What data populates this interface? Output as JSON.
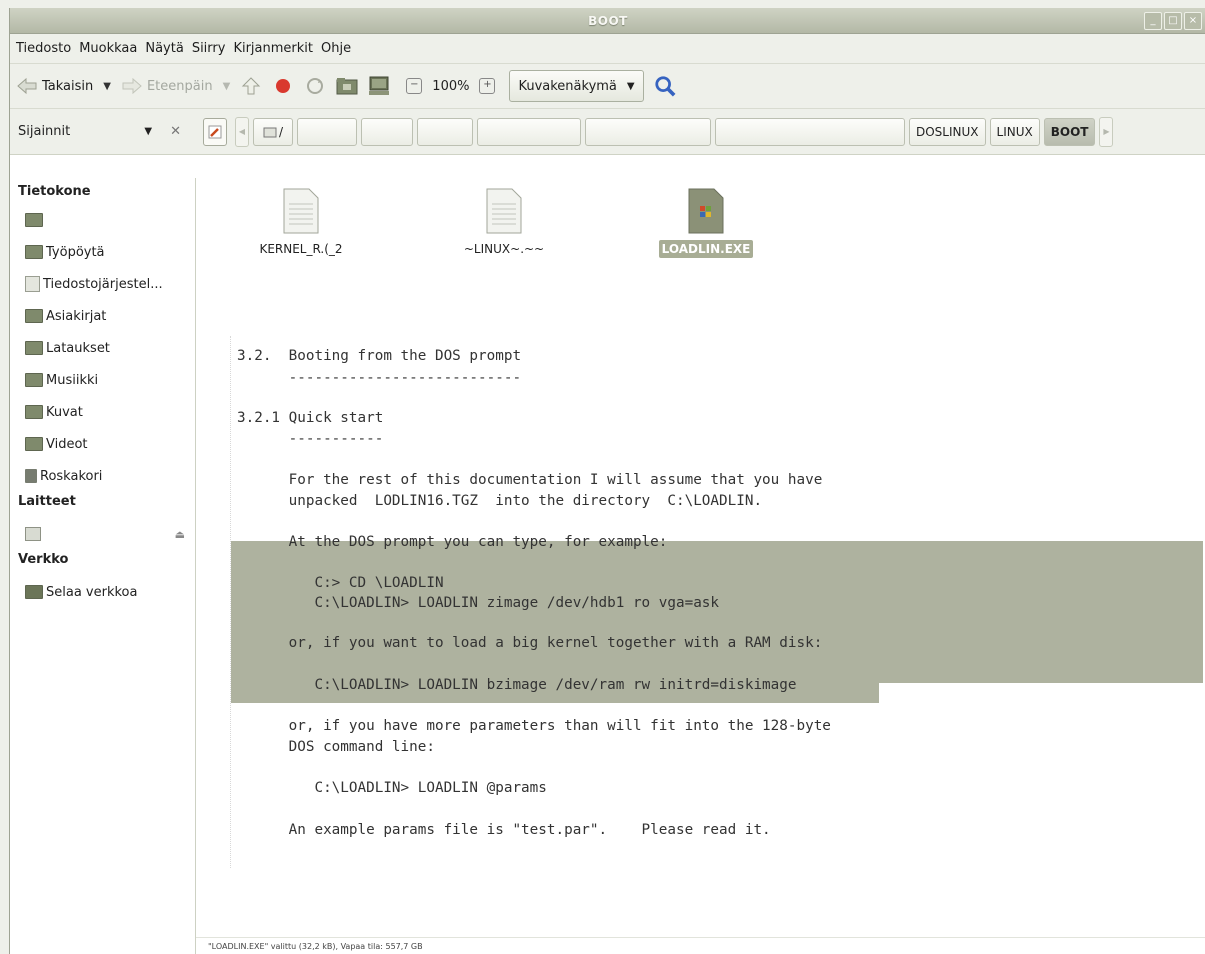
{
  "window": {
    "title": "BOOT"
  },
  "menu": [
    "Tiedosto",
    "Muokkaa",
    "Näytä",
    "Siirry",
    "Kirjanmerkit",
    "Ohje"
  ],
  "toolbar": {
    "back_label": "Takaisin",
    "forward_label": "Eteenpäin",
    "zoom_label": "100%",
    "view_mode": "Kuvakenäkymä"
  },
  "location": {
    "side_label": "Sijainnit",
    "crumbs": [
      "DOSLINUX",
      "LINUX",
      "BOOT"
    ]
  },
  "sidebar": {
    "computer_header": "Tietokone",
    "computer_items": [
      "Työpöytä",
      "Tiedostojärjestel...",
      "Asiakirjat",
      "Lataukset",
      "Musiikki",
      "Kuvat",
      "Videot",
      "Roskakori"
    ],
    "devices_header": "Laitteet",
    "network_header": "Verkko",
    "network_items": [
      "Selaa verkkoa"
    ]
  },
  "files": [
    {
      "name": "KERNEL_R.(_2",
      "selected": false
    },
    {
      "name": "~LINUX~.~~",
      "selected": false
    },
    {
      "name": "LOADLIN.EXE",
      "selected": true
    }
  ],
  "preview": {
    "lines": [
      "3.2.  Booting from the DOS prompt",
      "      ---------------------------",
      "3.2.1 Quick start",
      "      -----------",
      "      For the rest of this documentation I will assume that you have",
      "      unpacked  LODLIN16.TGZ  into the directory  C:\\LOADLIN.",
      "      At the DOS prompt you can type, for example:",
      "         C:> CD \\LOADLIN",
      "         C:\\LOADLIN> LOADLIN zimage /dev/hdb1 ro vga=ask",
      "      or, if you want to load a big kernel together with a RAM disk:",
      "         C:\\LOADLIN> LOADLIN bzimage /dev/ram rw initrd=diskimage",
      "      or, if you have more parameters than will fit into the 128-byte",
      "      DOS command line:",
      "         C:\\LOADLIN> LOADLIN @params",
      "      An example params file is \"test.par\".    Please read it."
    ]
  },
  "status": {
    "text": "\"LOADLIN.EXE\" valittu (32,2 kB), Vapaa tila: 557,7 GB"
  },
  "colors": {
    "highlight": "#aeb29f",
    "titlebar": "#b3b8a6",
    "selection": "#a8ad95"
  }
}
